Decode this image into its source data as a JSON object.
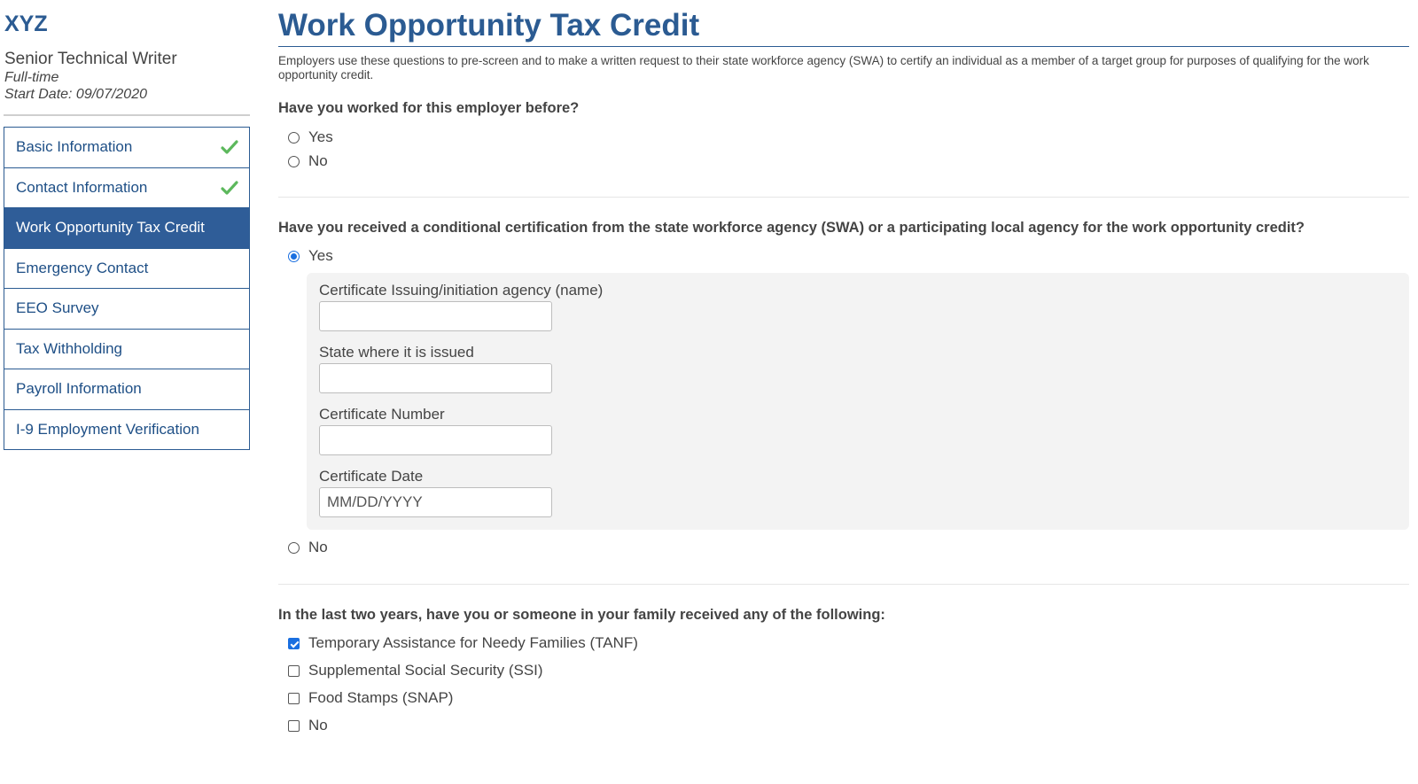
{
  "sidebar": {
    "company": "XYZ",
    "job_title": "Senior Technical Writer",
    "job_type": "Full-time",
    "start_date": "Start Date: 09/07/2020",
    "nav": [
      {
        "label": "Basic Information",
        "complete": true
      },
      {
        "label": "Contact Information",
        "complete": true
      },
      {
        "label": "Work Opportunity Tax Credit",
        "active": true
      },
      {
        "label": "Emergency Contact"
      },
      {
        "label": "EEO Survey"
      },
      {
        "label": "Tax Withholding"
      },
      {
        "label": "Payroll Information"
      },
      {
        "label": "I-9 Employment Verification"
      }
    ],
    "check_icon": "check-icon",
    "check_color": "#5cb85c"
  },
  "main": {
    "title": "Work Opportunity Tax Credit",
    "intro": "Employers use these questions to pre-screen and to make a written request to their state workforce agency (SWA) to certify an individual as a member of a target group for purposes of qualifying for the work opportunity credit.",
    "q1": {
      "question": "Have you worked for this employer before?",
      "options": [
        {
          "label": "Yes",
          "selected": false
        },
        {
          "label": "No",
          "selected": false
        }
      ]
    },
    "q2": {
      "question": "Have you received a conditional certification from the state workforce agency (SWA) or a participating local agency for the work opportunity credit?",
      "yes_label": "Yes",
      "yes_selected": true,
      "no_label": "No",
      "no_selected": false,
      "fields": {
        "agency_label": "Certificate Issuing/initiation agency (name)",
        "agency_value": "",
        "state_label": "State where it is issued",
        "state_value": "",
        "number_label": "Certificate Number",
        "number_value": "",
        "date_label": "Certificate Date",
        "date_value": "",
        "date_placeholder": "MM/DD/YYYY"
      }
    },
    "q3": {
      "question": "In the last two years, have you or someone in your family received any of the following:",
      "options": [
        {
          "label": "Temporary Assistance for Needy Families (TANF)",
          "checked": true
        },
        {
          "label": "Supplemental Social Security (SSI)",
          "checked": false
        },
        {
          "label": "Food Stamps (SNAP)",
          "checked": false
        },
        {
          "label": "No",
          "checked": false
        }
      ]
    }
  },
  "colors": {
    "brand": "#2b5b92",
    "nav_active_bg": "#2f5d98",
    "accent": "#1a6fe0"
  }
}
